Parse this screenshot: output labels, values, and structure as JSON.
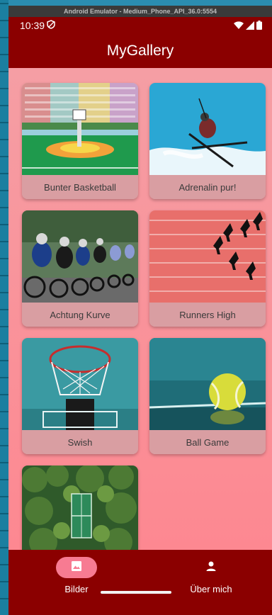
{
  "emulator": {
    "title": "Android Emulator - Medium_Phone_API_36.0:5554"
  },
  "status_bar": {
    "time": "10:39"
  },
  "app_bar": {
    "title": "MyGallery"
  },
  "gallery": {
    "items": [
      {
        "label": "Bunter Basketball"
      },
      {
        "label": "Adrenalin pur!"
      },
      {
        "label": "Achtung Kurve"
      },
      {
        "label": "Runners High"
      },
      {
        "label": "Swish"
      },
      {
        "label": "Ball Game"
      },
      {
        "label": ""
      }
    ]
  },
  "bottom_nav": {
    "items": [
      {
        "label": "Bilder",
        "icon": "image-icon",
        "active": true
      },
      {
        "label": "Über mich",
        "icon": "person-icon",
        "active": false
      }
    ]
  },
  "colors": {
    "app_bar": "#8b0000",
    "background_top": "#f59ea4",
    "background_bottom": "#fd8891",
    "nav_active_pill": "#f77b92",
    "card_label_bg": "#d99ea2"
  }
}
